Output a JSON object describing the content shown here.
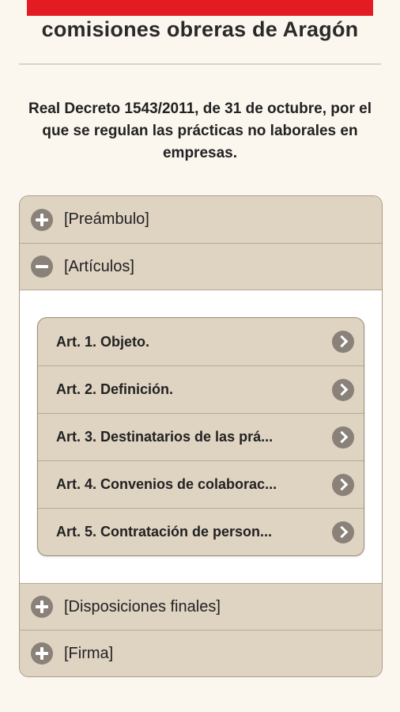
{
  "header": {
    "brand": "comisiones obreras de Aragón",
    "brand_color": "#e31b23"
  },
  "document": {
    "title": "Real Decreto 1543/2011, de 31 de octubre, por el que se regulan las prácticas no laborales en empresas."
  },
  "sections": [
    {
      "label": "[Preámbulo]",
      "icon": "plus-circle-icon",
      "expanded": false
    },
    {
      "label": "[Artículos]",
      "icon": "minus-circle-icon",
      "expanded": true
    },
    {
      "label": "[Disposiciones finales]",
      "icon": "plus-circle-icon",
      "expanded": false
    },
    {
      "label": "[Firma]",
      "icon": "plus-circle-icon",
      "expanded": false
    }
  ],
  "articles": [
    {
      "label": "Art. 1. Objeto.",
      "icon": "chevron-right-icon"
    },
    {
      "label": "Art. 2. Definición.",
      "icon": "chevron-right-icon"
    },
    {
      "label": "Art. 3. Destinatarios de las prá...",
      "icon": "chevron-right-icon"
    },
    {
      "label": "Art. 4. Convenios de colaborac...",
      "icon": "chevron-right-icon"
    },
    {
      "label": "Art. 5. Contratación de person...",
      "icon": "chevron-right-icon"
    }
  ]
}
